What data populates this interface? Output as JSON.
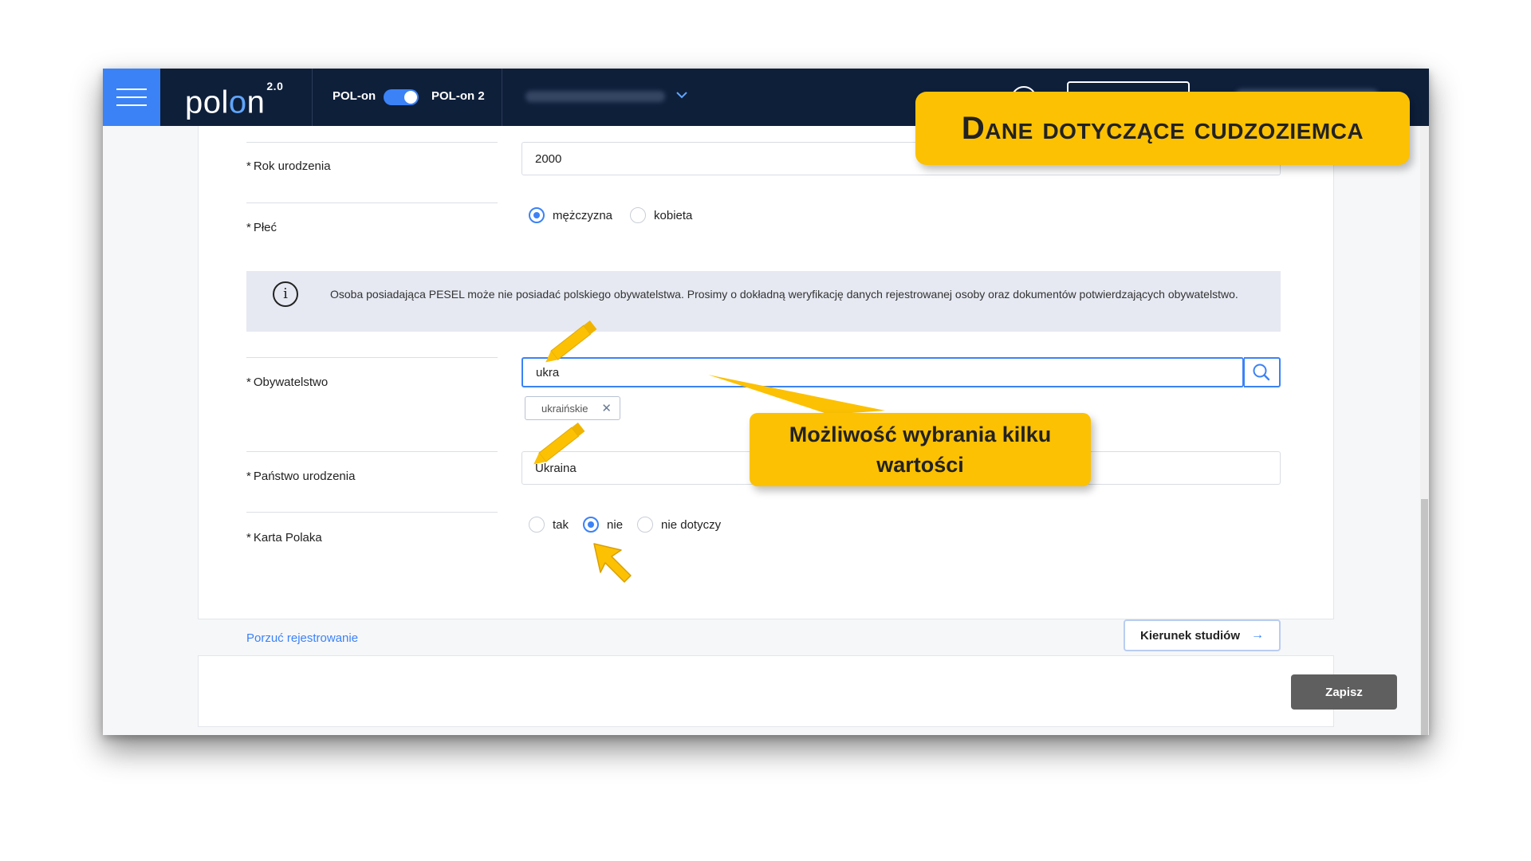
{
  "header": {
    "logo_text": "polon",
    "logo_version": "2.0",
    "mode_left": "POL-on",
    "mode_right": "POL-on 2"
  },
  "form": {
    "birth_year": {
      "label": "Rok urodzenia",
      "value": "2000"
    },
    "gender": {
      "label": "Płeć",
      "options": [
        "mężczyzna",
        "kobieta"
      ],
      "selected": "mężczyzna"
    },
    "info_message": "Osoba posiadająca PESEL może nie posiadać polskiego obywatelstwa. Prosimy o dokładną weryfikację danych rejestrowanej osoby oraz dokumentów potwierdzających obywatelstwo.",
    "citizenship": {
      "label": "Obywatelstwo",
      "value": "ukra",
      "chips": [
        "ukraińskie"
      ]
    },
    "birth_country": {
      "label": "Państwo urodzenia",
      "value": "Ukraina"
    },
    "karta_polaka": {
      "label": "Karta Polaka",
      "options": [
        "tak",
        "nie",
        "nie dotyczy"
      ],
      "selected": "nie"
    },
    "required_marker": "*",
    "abandon_link": "Porzuć rejestrowanie",
    "next_button": "Kierunek studiów",
    "save_button": "Zapisz"
  },
  "annotations": {
    "title": "Dane dotyczące cudzoziemca",
    "note": "Możliwość wybrania kilku wartości",
    "color": "#fcc103"
  },
  "colors": {
    "topbar": "#0e1f3a",
    "accent": "#3b82f6",
    "save": "#5f5f5f"
  }
}
